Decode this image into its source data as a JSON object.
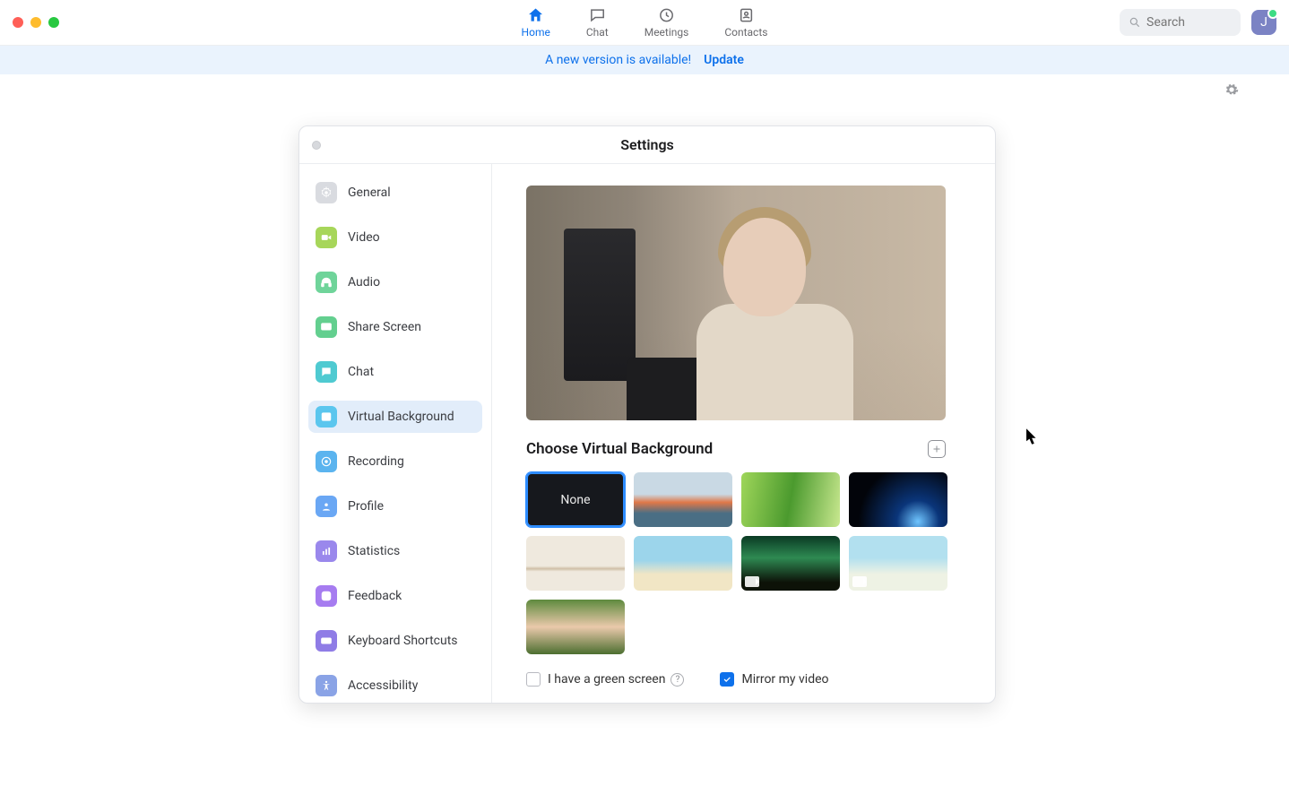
{
  "nav": {
    "items": [
      {
        "label": "Home",
        "active": true,
        "icon": "home"
      },
      {
        "label": "Chat",
        "active": false,
        "icon": "chat"
      },
      {
        "label": "Meetings",
        "active": false,
        "icon": "clock"
      },
      {
        "label": "Contacts",
        "active": false,
        "icon": "contacts"
      }
    ]
  },
  "search": {
    "placeholder": "Search"
  },
  "avatar": {
    "initial": "J"
  },
  "banner": {
    "message": "A new version is available!",
    "action": "Update"
  },
  "settings": {
    "title": "Settings",
    "sidebar": {
      "items": [
        {
          "label": "General",
          "icon": "gear",
          "color": "#d9dbe0"
        },
        {
          "label": "Video",
          "icon": "video",
          "color": "#a7d65a"
        },
        {
          "label": "Audio",
          "icon": "audio",
          "color": "#6fd49a"
        },
        {
          "label": "Share Screen",
          "icon": "share",
          "color": "#63cf8f"
        },
        {
          "label": "Chat",
          "icon": "chatb",
          "color": "#4fcad1"
        },
        {
          "label": "Virtual Background",
          "icon": "vb",
          "color": "#5bc6ee",
          "active": true
        },
        {
          "label": "Recording",
          "icon": "rec",
          "color": "#5bb4ef"
        },
        {
          "label": "Profile",
          "icon": "profile",
          "color": "#6aa7f4"
        },
        {
          "label": "Statistics",
          "icon": "stats",
          "color": "#9a88ec"
        },
        {
          "label": "Feedback",
          "icon": "feedback",
          "color": "#a67cf0"
        },
        {
          "label": "Keyboard Shortcuts",
          "icon": "keyboard",
          "color": "#8f7ce6"
        },
        {
          "label": "Accessibility",
          "icon": "a11y",
          "color": "#8aa3e6"
        }
      ]
    },
    "section_title": "Choose Virtual Background",
    "tiles": {
      "none_label": "None"
    },
    "checkboxes": {
      "green_screen": {
        "label": "I have a green screen",
        "checked": false
      },
      "mirror": {
        "label": "Mirror my video",
        "checked": true
      }
    }
  },
  "colors": {
    "accent": "#0e71eb"
  }
}
